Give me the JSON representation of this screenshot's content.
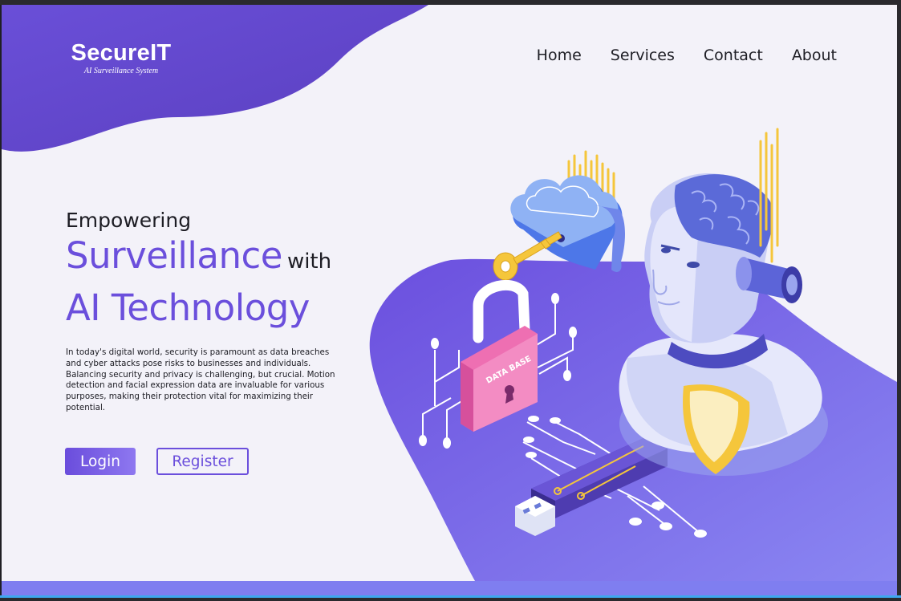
{
  "brand": {
    "name": "SecureIT",
    "tagline": "AI Surveillance System"
  },
  "nav": {
    "items": [
      {
        "label": "Home"
      },
      {
        "label": "Services"
      },
      {
        "label": "Contact"
      },
      {
        "label": "About"
      }
    ]
  },
  "hero": {
    "eyebrow": "Empowering",
    "line1": "Surveillance",
    "line1_suffix": "with",
    "line2": "AI Technology",
    "body": "In today's digital world, security is paramount as data breaches and cyber attacks pose risks to businesses and individuals. Balancing security and privacy is challenging, but crucial. Motion detection and facial expression data are invaluable for various purposes, making their protection vital for maximizing their potential."
  },
  "actions": {
    "login_label": "Login",
    "register_label": "Register"
  },
  "illustration": {
    "padlock_label": "DATA BASE",
    "elements": [
      "cloud-icon",
      "key-icon",
      "padlock-icon",
      "robot-head",
      "shield-icon",
      "usb-drive-icon",
      "circuit-lines"
    ]
  },
  "colors": {
    "primary": "#6b4fdc",
    "accent_light": "#8e78f0",
    "page_bg": "#f3f2f9",
    "text": "#1d1d24",
    "highlight_yellow": "#f5c63b",
    "lock_pink": "#ee6fb2"
  }
}
